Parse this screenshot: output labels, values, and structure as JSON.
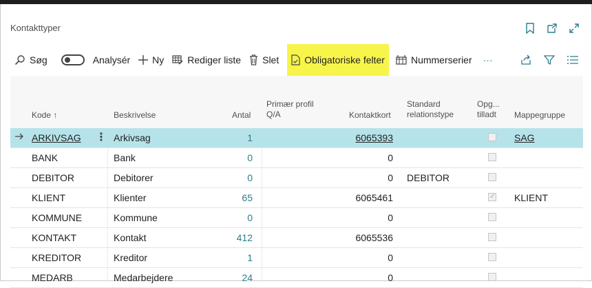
{
  "page": {
    "title": "Kontakttyper"
  },
  "toolbar": {
    "search": "Søg",
    "analyze": "Analysér",
    "new": "Ny",
    "edit_list": "Rediger liste",
    "delete": "Slet",
    "mandatory": "Obligatoriske felter",
    "numberseries": "Nummerserier",
    "more": "···"
  },
  "columns": {
    "kode": "Kode",
    "kode_sort": "↑",
    "besk": "Beskrivelse",
    "antal": "Antal",
    "primaer1": "Primær profil",
    "primaer2": "Q/A",
    "kontaktkort": "Kontaktkort",
    "std1": "Standard",
    "std2": "relationstype",
    "opg1": "Opg...",
    "opg2": "tilladt",
    "mappe": "Mappegruppe"
  },
  "rows": [
    {
      "kode": "ARKIVSAG",
      "besk": "Arkivsag",
      "antal": "1",
      "kontaktkort": "6065393",
      "std": "",
      "opg": false,
      "mappe": "SAG"
    },
    {
      "kode": "BANK",
      "besk": "Bank",
      "antal": "0",
      "kontaktkort": "0",
      "std": "",
      "opg": false,
      "mappe": ""
    },
    {
      "kode": "DEBITOR",
      "besk": "Debitorer",
      "antal": "0",
      "kontaktkort": "0",
      "std": "DEBITOR",
      "opg": false,
      "mappe": ""
    },
    {
      "kode": "KLIENT",
      "besk": "Klienter",
      "antal": "65",
      "kontaktkort": "6065461",
      "std": "",
      "opg": true,
      "mappe": "KLIENT"
    },
    {
      "kode": "KOMMUNE",
      "besk": "Kommune",
      "antal": "0",
      "kontaktkort": "0",
      "std": "",
      "opg": false,
      "mappe": ""
    },
    {
      "kode": "KONTAKT",
      "besk": "Kontakt",
      "antal": "412",
      "kontaktkort": "6065536",
      "std": "",
      "opg": false,
      "mappe": ""
    },
    {
      "kode": "KREDITOR",
      "besk": "Kreditor",
      "antal": "1",
      "kontaktkort": "0",
      "std": "",
      "opg": false,
      "mappe": ""
    },
    {
      "kode": "MEDARB",
      "besk": "Medarbejdere",
      "antal": "24",
      "kontaktkort": "0",
      "std": "",
      "opg": false,
      "mappe": ""
    }
  ],
  "colors": {
    "highlight": "#f7f44a",
    "selected_row": "#b6e3ea",
    "link": "#2a7d8b"
  }
}
